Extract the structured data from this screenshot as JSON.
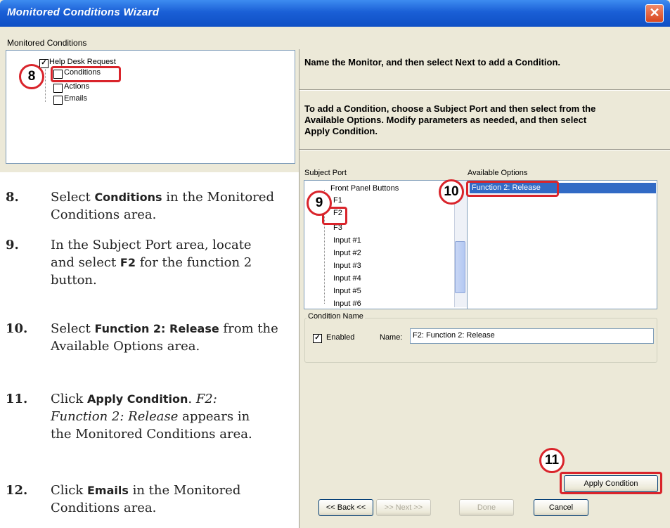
{
  "window": {
    "title": "Monitored Conditions Wizard",
    "close_glyph": "✕"
  },
  "monitored": {
    "group_label": "Monitored Conditions",
    "tree": [
      "Help Desk Request",
      "Conditions",
      "Actions",
      "Emails"
    ]
  },
  "right": {
    "instruction1": "Name the Monitor, and then select Next to add a Condition.",
    "instruction2": "To add a Condition, choose a Subject Port and then select from the Available Options. Modify parameters as needed, and then select Apply Condition."
  },
  "subject_port": {
    "label": "Subject Port",
    "items": [
      "Front Panel Buttons",
      "F1",
      "F2",
      "F3",
      "Input #1",
      "Input #2",
      "Input #3",
      "Input #4",
      "Input #5",
      "Input #6"
    ]
  },
  "available": {
    "label": "Available Options",
    "items": [
      "Function 2: Release"
    ]
  },
  "condition_name": {
    "group_label": "Condition Name",
    "enabled_label": "Enabled",
    "enabled_mark": "✓",
    "name_label": "Name:",
    "name_value": "F2: Function 2: Release"
  },
  "buttons": {
    "apply": "Apply Condition",
    "back": "<< Back <<",
    "next": ">> Next >>",
    "done": "Done",
    "cancel": "Cancel"
  },
  "callouts": [
    "8",
    "9",
    "10",
    "11"
  ],
  "steps": [
    {
      "num": "8.",
      "parts": [
        {
          "t": "Select "
        },
        {
          "t": "Conditions",
          "b": true
        },
        {
          "t": " in the Monitored Conditions area."
        }
      ]
    },
    {
      "num": "9.",
      "parts": [
        {
          "t": "In the Subject Port area, locate and select "
        },
        {
          "t": "F2",
          "b": true
        },
        {
          "t": " for the function 2 button."
        }
      ]
    },
    {
      "num": "10.",
      "parts": [
        {
          "t": "Select "
        },
        {
          "t": "Function 2: Release",
          "b": true
        },
        {
          "t": " from the Available Options area."
        }
      ]
    },
    {
      "num": "11.",
      "parts": [
        {
          "t": "Click "
        },
        {
          "t": "Apply Condition",
          "b": true
        },
        {
          "t": ". "
        },
        {
          "t": "F2: Function 2: Release",
          "i": true
        },
        {
          "t": " appears in the Monitored Conditions area."
        }
      ]
    },
    {
      "num": "12.",
      "parts": [
        {
          "t": "Click "
        },
        {
          "t": "Emails",
          "b": true
        },
        {
          "t": " in the Monitored Conditions area."
        }
      ]
    }
  ]
}
